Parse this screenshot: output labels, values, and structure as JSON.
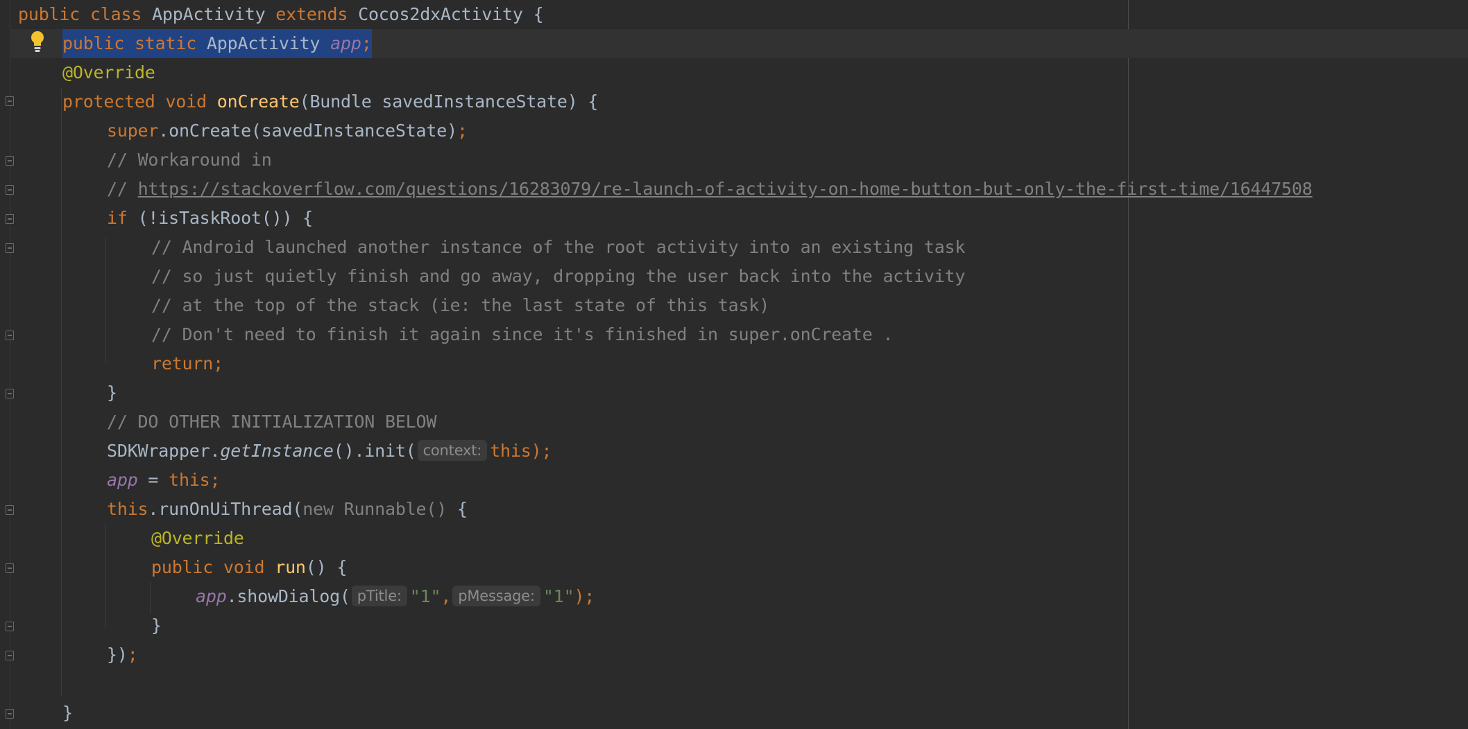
{
  "editor": {
    "lines": {
      "l1": {
        "t1": "public class ",
        "t2": "AppActivity ",
        "t3": "extends ",
        "t4": "Cocos2dxActivity {"
      },
      "l2": {
        "t1": "public static ",
        "t2": "AppActivity ",
        "t3": "app",
        "t4": ";"
      },
      "l3": {
        "t1": "@Override"
      },
      "l4": {
        "t1": "protected void ",
        "t2": "onCreate",
        "t3": "(Bundle savedInstanceState) {"
      },
      "l5": {
        "t1": "super",
        "t2": ".onCreate(savedInstanceState)",
        "t3": ";"
      },
      "l6": {
        "t1": "// Workaround in"
      },
      "l7": {
        "t1": "// ",
        "t2": "https://stackoverflow.com/questions/16283079/re-launch-of-activity-on-home-button-but-only-the-first-time/16447508"
      },
      "l8": {
        "t1": "if ",
        "t2": "(!isTaskRoot()) {"
      },
      "l9": {
        "t1": "// Android launched another instance of the root activity into an existing task"
      },
      "l10": {
        "t1": "// so just quietly finish and go away, dropping the user back into the activity"
      },
      "l11": {
        "t1": "// at the top of the stack (ie: the last state of this task)"
      },
      "l12": {
        "t1": "// Don't need to finish it again since it's finished in super.onCreate ."
      },
      "l13": {
        "t1": "return;"
      },
      "l14": {
        "t1": "}"
      },
      "l15": {
        "t1": "// DO OTHER INITIALIZATION BELOW"
      },
      "l16": {
        "t1": "SDKWrapper.",
        "t2": "getInstance",
        "t3": "().init(",
        "hint": "context:",
        "t4": "this",
        "t5": ");"
      },
      "l17": {
        "t1": "app",
        "t2": " = ",
        "t3": "this",
        "t4": ";"
      },
      "l18": {
        "t1": "this",
        "t2": ".runOnUiThread(",
        "t3": "new ",
        "t4": "Runnable() ",
        "t5": "{"
      },
      "l19": {
        "t1": "@Override"
      },
      "l20": {
        "t1": "public void ",
        "t2": "run",
        "t3": "() {"
      },
      "l21": {
        "t1": "app",
        "t2": ".showDialog(",
        "hint1": "pTitle:",
        "t3": "\"1\"",
        "t4": ",",
        "hint2": "pMessage:",
        "t5": "\"1\"",
        "t6": ");"
      },
      "l22": {
        "t1": "}"
      },
      "l23": {
        "t1": "})",
        "t2": ";"
      },
      "l25": {
        "t1": "}"
      }
    },
    "colors": {
      "background": "#2b2b2b",
      "keyword": "#cc7832",
      "annotation": "#bbb529",
      "method": "#ffc66d",
      "field": "#9876aa",
      "comment": "#808080",
      "string": "#6a8759",
      "selection": "#214283"
    },
    "icons": {
      "intention": "lightbulb-icon",
      "fold": "fold-marker-icon"
    }
  }
}
